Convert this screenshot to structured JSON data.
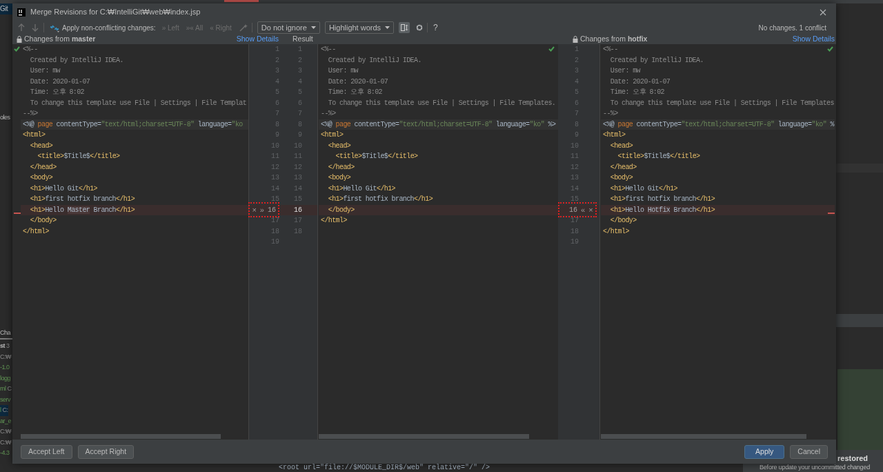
{
  "background": {
    "top_label": "Git",
    "side_label": "oles",
    "panel_title": "Cha",
    "file_list": [
      {
        "name": "st",
        "path": "3",
        "kind": "header",
        "selected": false
      },
      {
        "path": "C:₩",
        "kind": "path",
        "selected": false
      },
      {
        "name": "-1.0",
        "kind": "file",
        "selected": false
      },
      {
        "name": "logg",
        "kind": "file",
        "selected": false
      },
      {
        "name": "ml",
        "path": "C",
        "kind": "file",
        "selected": false
      },
      {
        "name": "serv",
        "kind": "file",
        "selected": false
      },
      {
        "name": "l",
        "path": "C:",
        "kind": "file",
        "selected": true
      },
      {
        "name": "ar_e",
        "kind": "file",
        "selected": false
      },
      {
        "path": "C:₩",
        "kind": "path",
        "selected": false
      },
      {
        "path": "C:₩",
        "kind": "path",
        "selected": false
      },
      {
        "name": "-4.3",
        "kind": "file",
        "selected": false
      }
    ],
    "editor_line_code": "<root url=\"file://$MODULE_DIR$/web\" relative=\"/\" />",
    "notification": {
      "title": "restored",
      "text": "Before update your uncommitted changed"
    }
  },
  "window": {
    "title": "Merge Revisions for C:₩IntelliGit₩web₩index.jsp"
  },
  "toolbar": {
    "apply_label": "Apply non-conflicting changes:",
    "apply_buttons": [
      {
        "icon": "»",
        "label": "Left",
        "disabled": true
      },
      {
        "icon": "»«",
        "label": "All",
        "disabled": true
      },
      {
        "icon": "«",
        "label": "Right",
        "disabled": true
      }
    ],
    "dropdowns": [
      "Do not ignore",
      "Highlight words"
    ],
    "help": "?",
    "status": "No changes. 1 conflict"
  },
  "left": {
    "header": "Changes from **master**",
    "show_details": "Show Details",
    "lines": [
      {
        "kind": "normal",
        "tokens": [
          {
            "text": "<%--",
            "kind": "comment"
          }
        ]
      },
      {
        "kind": "normal",
        "tokens": [
          {
            "text": "  Created by IntelliJ IDEA.",
            "kind": "comment"
          }
        ]
      },
      {
        "kind": "normal",
        "tokens": [
          {
            "text": "  User: mw",
            "kind": "comment"
          }
        ]
      },
      {
        "kind": "normal",
        "tokens": [
          {
            "text": "  Date: 2020-01-07",
            "kind": "comment"
          }
        ]
      },
      {
        "kind": "normal",
        "tokens": [
          {
            "text": "  Time: 오후 8:02",
            "kind": "comment"
          }
        ]
      },
      {
        "kind": "normal",
        "tokens": [
          {
            "text": "  To change this template use File | Settings | File Templat",
            "kind": "comment"
          }
        ]
      },
      {
        "kind": "normal",
        "tokens": [
          {
            "text": "--%>",
            "kind": "comment"
          }
        ]
      },
      {
        "kind": "current",
        "tokens": [
          {
            "text": "<%@ ",
            "kind": "text"
          },
          {
            "text": "page",
            "kind": "keyword"
          },
          {
            "text": " contentType=",
            "kind": "text"
          },
          {
            "text": "\"text/html;charset=UTF-8\"",
            "kind": "string"
          },
          {
            "text": " language=",
            "kind": "text"
          },
          {
            "text": "\"ko",
            "kind": "string"
          }
        ]
      },
      {
        "kind": "normal",
        "tokens": [
          {
            "text": "<html>",
            "kind": "tag"
          }
        ]
      },
      {
        "kind": "normal",
        "tokens": [
          {
            "text": "  <head>",
            "kind": "tag"
          }
        ]
      },
      {
        "kind": "normal",
        "tokens": [
          {
            "text": "    <title>",
            "kind": "tag"
          },
          {
            "text": "$Title$",
            "kind": "text"
          },
          {
            "text": "</title>",
            "kind": "tag"
          }
        ]
      },
      {
        "kind": "normal",
        "tokens": [
          {
            "text": "  </head>",
            "kind": "tag"
          }
        ]
      },
      {
        "kind": "normal",
        "tokens": [
          {
            "text": "  <body>",
            "kind": "tag"
          }
        ]
      },
      {
        "kind": "normal",
        "tokens": [
          {
            "text": "  <h1>",
            "kind": "tag"
          },
          {
            "text": "Hello Git",
            "kind": "text"
          },
          {
            "text": "</h1>",
            "kind": "tag"
          }
        ]
      },
      {
        "kind": "normal",
        "tokens": [
          {
            "text": "  <h1>",
            "kind": "tag"
          },
          {
            "text": "first hotfix branch",
            "kind": "text"
          },
          {
            "text": "</h1>",
            "kind": "tag"
          }
        ]
      },
      {
        "kind": "conflict",
        "tokens": [
          {
            "text": "  <h1>",
            "kind": "tag"
          },
          {
            "text": "Hello ",
            "kind": "text"
          },
          {
            "text": "Master",
            "kind": "changed"
          },
          {
            "text": " Branch",
            "kind": "text"
          },
          {
            "text": "</h1>",
            "kind": "tag"
          }
        ]
      },
      {
        "kind": "normal",
        "tokens": [
          {
            "text": "  </body>",
            "kind": "tag"
          }
        ]
      },
      {
        "kind": "normal",
        "tokens": [
          {
            "text": "</html>",
            "kind": "tag"
          }
        ]
      }
    ]
  },
  "result": {
    "header": "Result",
    "lines": [
      {
        "kind": "normal",
        "tokens": [
          {
            "text": "<%--",
            "kind": "comment"
          }
        ]
      },
      {
        "kind": "normal",
        "tokens": [
          {
            "text": "  Created by IntelliJ IDEA.",
            "kind": "comment"
          }
        ]
      },
      {
        "kind": "normal",
        "tokens": [
          {
            "text": "  User: mw",
            "kind": "comment"
          }
        ]
      },
      {
        "kind": "normal",
        "tokens": [
          {
            "text": "  Date: 2020-01-07",
            "kind": "comment"
          }
        ]
      },
      {
        "kind": "normal",
        "tokens": [
          {
            "text": "  Time: 오후 8:02",
            "kind": "comment"
          }
        ]
      },
      {
        "kind": "normal",
        "tokens": [
          {
            "text": "  To change this template use File | Settings | File Templates.",
            "kind": "comment"
          }
        ]
      },
      {
        "kind": "normal",
        "tokens": [
          {
            "text": "--%>",
            "kind": "comment"
          }
        ]
      },
      {
        "kind": "current",
        "tokens": [
          {
            "text": "<%@ ",
            "kind": "text"
          },
          {
            "text": "page",
            "kind": "keyword"
          },
          {
            "text": " contentType=",
            "kind": "text"
          },
          {
            "text": "\"text/html;charset=UTF-8\"",
            "kind": "string"
          },
          {
            "text": " language=",
            "kind": "text"
          },
          {
            "text": "\"ko\"",
            "kind": "string"
          },
          {
            "text": " %>",
            "kind": "text"
          }
        ]
      },
      {
        "kind": "normal",
        "tokens": [
          {
            "text": "<html>",
            "kind": "tag"
          }
        ]
      },
      {
        "kind": "normal",
        "tokens": [
          {
            "text": "  <head>",
            "kind": "tag"
          }
        ]
      },
      {
        "kind": "normal",
        "tokens": [
          {
            "text": "    <title>",
            "kind": "tag"
          },
          {
            "text": "$Title$",
            "kind": "text"
          },
          {
            "text": "</title>",
            "kind": "tag"
          }
        ]
      },
      {
        "kind": "normal",
        "tokens": [
          {
            "text": "  </head>",
            "kind": "tag"
          }
        ]
      },
      {
        "kind": "normal",
        "tokens": [
          {
            "text": "  <body>",
            "kind": "tag"
          }
        ]
      },
      {
        "kind": "normal",
        "tokens": [
          {
            "text": "  <h1>",
            "kind": "tag"
          },
          {
            "text": "Hello Git",
            "kind": "text"
          },
          {
            "text": "</h1>",
            "kind": "tag"
          }
        ]
      },
      {
        "kind": "normal",
        "tokens": [
          {
            "text": "  <h1>",
            "kind": "tag"
          },
          {
            "text": "first hotfix branch",
            "kind": "text"
          },
          {
            "text": "</h1>",
            "kind": "tag"
          }
        ]
      },
      {
        "kind": "conflict",
        "tokens": [
          {
            "text": "  </body>",
            "kind": "tag"
          }
        ]
      },
      {
        "kind": "normal",
        "tokens": [
          {
            "text": "</html>",
            "kind": "tag"
          }
        ]
      }
    ]
  },
  "right": {
    "header": "Changes from **hotfix**",
    "show_details": "Show Details",
    "lines": [
      {
        "kind": "normal",
        "tokens": [
          {
            "text": "<%--",
            "kind": "comment"
          }
        ]
      },
      {
        "kind": "normal",
        "tokens": [
          {
            "text": "  Created by IntelliJ IDEA.",
            "kind": "comment"
          }
        ]
      },
      {
        "kind": "normal",
        "tokens": [
          {
            "text": "  User: mw",
            "kind": "comment"
          }
        ]
      },
      {
        "kind": "normal",
        "tokens": [
          {
            "text": "  Date: 2020-01-07",
            "kind": "comment"
          }
        ]
      },
      {
        "kind": "normal",
        "tokens": [
          {
            "text": "  Time: 오후 8:02",
            "kind": "comment"
          }
        ]
      },
      {
        "kind": "normal",
        "tokens": [
          {
            "text": "  To change this template use File | Settings | File Templates",
            "kind": "comment"
          }
        ]
      },
      {
        "kind": "normal",
        "tokens": [
          {
            "text": "--%>",
            "kind": "comment"
          }
        ]
      },
      {
        "kind": "current",
        "tokens": [
          {
            "text": "<%@ ",
            "kind": "text"
          },
          {
            "text": "page",
            "kind": "keyword"
          },
          {
            "text": " contentType=",
            "kind": "text"
          },
          {
            "text": "\"text/html;charset=UTF-8\"",
            "kind": "string"
          },
          {
            "text": " language=",
            "kind": "text"
          },
          {
            "text": "\"ko\"",
            "kind": "string"
          },
          {
            "text": " %",
            "kind": "text"
          }
        ]
      },
      {
        "kind": "normal",
        "tokens": [
          {
            "text": "<html>",
            "kind": "tag"
          }
        ]
      },
      {
        "kind": "normal",
        "tokens": [
          {
            "text": "  <head>",
            "kind": "tag"
          }
        ]
      },
      {
        "kind": "normal",
        "tokens": [
          {
            "text": "    <title>",
            "kind": "tag"
          },
          {
            "text": "$Title$",
            "kind": "text"
          },
          {
            "text": "</title>",
            "kind": "tag"
          }
        ]
      },
      {
        "kind": "normal",
        "tokens": [
          {
            "text": "  </head>",
            "kind": "tag"
          }
        ]
      },
      {
        "kind": "normal",
        "tokens": [
          {
            "text": "  <body>",
            "kind": "tag"
          }
        ]
      },
      {
        "kind": "normal",
        "tokens": [
          {
            "text": "  <h1>",
            "kind": "tag"
          },
          {
            "text": "Hello Git",
            "kind": "text"
          },
          {
            "text": "</h1>",
            "kind": "tag"
          }
        ]
      },
      {
        "kind": "normal",
        "tokens": [
          {
            "text": "  <h1>",
            "kind": "tag"
          },
          {
            "text": "first hotfix branch",
            "kind": "text"
          },
          {
            "text": "</h1>",
            "kind": "tag"
          }
        ]
      },
      {
        "kind": "conflict",
        "tokens": [
          {
            "text": "  <h1>",
            "kind": "tag"
          },
          {
            "text": "Hello ",
            "kind": "text"
          },
          {
            "text": "Hotfix",
            "kind": "changed"
          },
          {
            "text": " Branch",
            "kind": "text"
          },
          {
            "text": "</h1>",
            "kind": "tag"
          }
        ]
      },
      {
        "kind": "normal",
        "tokens": [
          {
            "text": "  </body>",
            "kind": "tag"
          }
        ]
      },
      {
        "kind": "normal",
        "tokens": [
          {
            "text": "</html>",
            "kind": "tag"
          }
        ]
      }
    ]
  },
  "gutters": {
    "left_numbers": [
      {
        "n": "1",
        "kind": "plain"
      },
      {
        "n": "2",
        "kind": "plain"
      },
      {
        "n": "3",
        "kind": "plain"
      },
      {
        "n": "4",
        "kind": "plain"
      },
      {
        "n": "5",
        "kind": "plain"
      },
      {
        "n": "6",
        "kind": "plain"
      },
      {
        "n": "7",
        "kind": "plain"
      },
      {
        "n": "8",
        "kind": "plain"
      },
      {
        "n": "9",
        "kind": "plain"
      },
      {
        "n": "10",
        "kind": "plain"
      },
      {
        "n": "11",
        "kind": "plain"
      },
      {
        "n": "12",
        "kind": "plain"
      },
      {
        "n": "13",
        "kind": "plain"
      },
      {
        "n": "14",
        "kind": "plain"
      },
      {
        "n": "15",
        "kind": "plain"
      },
      {
        "n": "16",
        "kind": "conflict",
        "marks": [
          "×",
          "»"
        ]
      },
      {
        "n": "17",
        "kind": "plain"
      },
      {
        "n": "18",
        "kind": "plain"
      },
      {
        "n": "19",
        "kind": "plain"
      }
    ],
    "result_numbers": [
      {
        "n": "1",
        "kind": "plain"
      },
      {
        "n": "2",
        "kind": "plain"
      },
      {
        "n": "3",
        "kind": "plain"
      },
      {
        "n": "4",
        "kind": "plain"
      },
      {
        "n": "5",
        "kind": "plain"
      },
      {
        "n": "6",
        "kind": "plain"
      },
      {
        "n": "7",
        "kind": "plain"
      },
      {
        "n": "8",
        "kind": "plain"
      },
      {
        "n": "9",
        "kind": "plain"
      },
      {
        "n": "10",
        "kind": "plain"
      },
      {
        "n": "11",
        "kind": "plain"
      },
      {
        "n": "12",
        "kind": "plain"
      },
      {
        "n": "13",
        "kind": "plain"
      },
      {
        "n": "14",
        "kind": "plain"
      },
      {
        "n": "15",
        "kind": "plain"
      },
      {
        "n": "16",
        "kind": "conflict"
      },
      {
        "n": "17",
        "kind": "plain"
      },
      {
        "n": "18",
        "kind": "plain"
      }
    ],
    "right_numbers": [
      {
        "n": "1",
        "kind": "plain"
      },
      {
        "n": "2",
        "kind": "plain"
      },
      {
        "n": "3",
        "kind": "plain"
      },
      {
        "n": "4",
        "kind": "plain"
      },
      {
        "n": "5",
        "kind": "plain"
      },
      {
        "n": "6",
        "kind": "plain"
      },
      {
        "n": "7",
        "kind": "plain"
      },
      {
        "n": "8",
        "kind": "plain"
      },
      {
        "n": "9",
        "kind": "plain"
      },
      {
        "n": "10",
        "kind": "plain"
      },
      {
        "n": "11",
        "kind": "plain"
      },
      {
        "n": "12",
        "kind": "plain"
      },
      {
        "n": "13",
        "kind": "plain"
      },
      {
        "n": "14",
        "kind": "plain"
      },
      {
        "n": "15",
        "kind": "plain"
      },
      {
        "n": "16",
        "kind": "conflict",
        "marks": [
          "«",
          "×"
        ]
      },
      {
        "n": "17",
        "kind": "plain"
      },
      {
        "n": "18",
        "kind": "plain"
      },
      {
        "n": "19",
        "kind": "plain"
      }
    ]
  },
  "left_buttons": [
    {
      "label": "Accept Left",
      "primary": false
    },
    {
      "label": "Accept Right",
      "primary": false
    }
  ],
  "right_buttons": [
    {
      "label": "Apply",
      "primary": true
    },
    {
      "label": "Cancel",
      "primary": false
    }
  ]
}
